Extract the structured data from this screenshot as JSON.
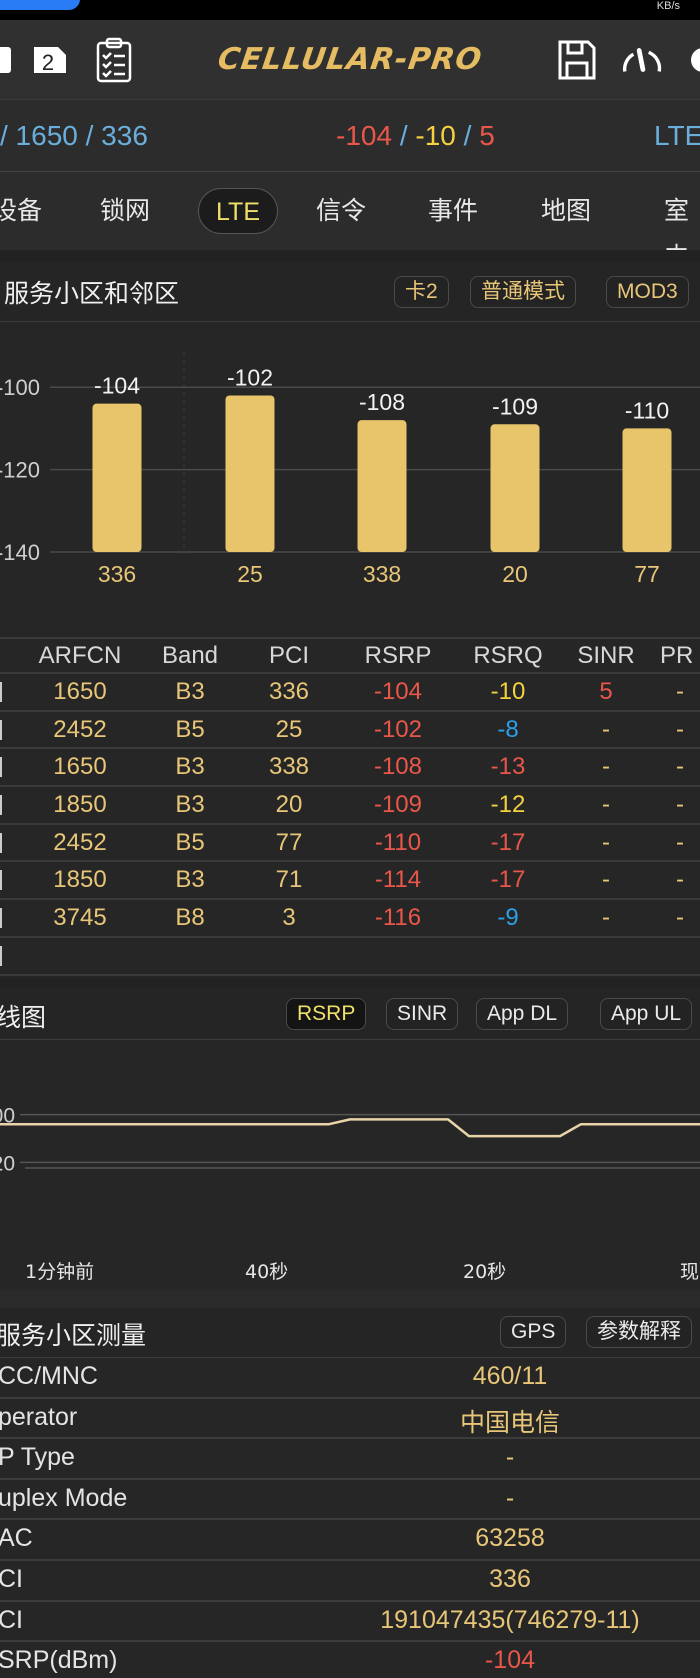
{
  "status_bar": {
    "right_text": "KB/s"
  },
  "app_bar": {
    "title": "CELLULAR-PRO",
    "sim_badge": "2",
    "icons": [
      "sim-card-icon",
      "clipboard-checklist-icon",
      "save-icon",
      "speedometer-icon",
      "settings-icon"
    ]
  },
  "summary": {
    "left": "/ 1650 / 336",
    "rsrp": "-104",
    "rsrq": "-10",
    "sinr": "5",
    "sep": "/",
    "tech": "LTE"
  },
  "tabs": [
    {
      "label": "设备",
      "active": false
    },
    {
      "label": "锁网",
      "active": false
    },
    {
      "label": "LTE",
      "active": true
    },
    {
      "label": "信令",
      "active": false
    },
    {
      "label": "事件",
      "active": false
    },
    {
      "label": "地图",
      "active": false
    },
    {
      "label": "室内",
      "active": false
    }
  ],
  "cells_section": {
    "title": "服务小区和邻区",
    "chips": [
      "卡2",
      "普通模式",
      "MOD3"
    ]
  },
  "chart_data": [
    {
      "type": "bar",
      "title": "RSRP by PCI",
      "categories": [
        "336",
        "25",
        "338",
        "20",
        "77"
      ],
      "values": [
        -104,
        -102,
        -108,
        -109,
        -110
      ],
      "data_labels": [
        "-104",
        "-102",
        "-108",
        "-109",
        "-110"
      ],
      "ytick_labels": [
        "-100",
        "-120",
        "-140"
      ],
      "yticks": [
        -100,
        -120,
        -140
      ],
      "ylim": [
        -140,
        -90
      ],
      "color": "#e8c46a",
      "grid": true
    },
    {
      "type": "line",
      "title": "RSRP trend",
      "x_labels": [
        "1分钟前",
        "40秒",
        "20秒",
        "现"
      ],
      "ytick_labels": [
        "00",
        "20"
      ],
      "yticks": [
        -100,
        -120
      ],
      "ylim": [
        -140,
        -80
      ],
      "x": [
        0,
        0.47,
        0.5,
        0.64,
        0.67,
        0.8,
        0.83,
        1
      ],
      "values": [
        -104,
        -104,
        -102,
        -102,
        -109,
        -109,
        -104,
        -104
      ],
      "color": "#e8d4a8",
      "grid": true
    }
  ],
  "table": {
    "headers": [
      "ARFCN",
      "Band",
      "PCI",
      "RSRP",
      "RSRQ",
      "SINR",
      "PR"
    ],
    "rows": [
      {
        "lead": "P",
        "arfcn": "1650",
        "band": "B3",
        "pci": "336",
        "rsrp": "-104",
        "rsrq": "-10",
        "rsrq_color": "yellow",
        "sinr": "5",
        "sinr_color": "red",
        "pr": "-"
      },
      {
        "lead": "N",
        "arfcn": "2452",
        "band": "B5",
        "pci": "25",
        "rsrp": "-102",
        "rsrq": "-8",
        "rsrq_color": "lightblue",
        "sinr": "-",
        "sinr_color": "gold",
        "pr": "-"
      },
      {
        "lead": "N",
        "arfcn": "1650",
        "band": "B3",
        "pci": "338",
        "rsrp": "-108",
        "rsrq": "-13",
        "rsrq_color": "red",
        "sinr": "-",
        "sinr_color": "gold",
        "pr": "-"
      },
      {
        "lead": "N",
        "arfcn": "1850",
        "band": "B3",
        "pci": "20",
        "rsrp": "-109",
        "rsrq": "-12",
        "rsrq_color": "yellow",
        "sinr": "-",
        "sinr_color": "gold",
        "pr": "-"
      },
      {
        "lead": "N",
        "arfcn": "2452",
        "band": "B5",
        "pci": "77",
        "rsrp": "-110",
        "rsrq": "-17",
        "rsrq_color": "red",
        "sinr": "-",
        "sinr_color": "gold",
        "pr": "-"
      },
      {
        "lead": "N",
        "arfcn": "1850",
        "band": "B3",
        "pci": "71",
        "rsrp": "-114",
        "rsrq": "-17",
        "rsrq_color": "red",
        "sinr": "-",
        "sinr_color": "gold",
        "pr": "-"
      },
      {
        "lead": "N",
        "arfcn": "3745",
        "band": "B8",
        "pci": "3",
        "rsrp": "-116",
        "rsrq": "-9",
        "rsrq_color": "lightblue",
        "sinr": "-",
        "sinr_color": "gold",
        "pr": "-"
      },
      {
        "lead": "N",
        "arfcn": "",
        "band": "",
        "pci": "",
        "rsrp": "",
        "rsrq": "",
        "rsrq_color": "gold",
        "sinr": "",
        "sinr_color": "gold",
        "pr": ""
      }
    ]
  },
  "trend_section": {
    "title": "线图",
    "chips": [
      "RSRP",
      "SINR",
      "App DL",
      "App UL"
    ],
    "selected": "RSRP"
  },
  "measure_section": {
    "title": "服务小区测量",
    "chips": [
      "GPS",
      "参数解释"
    ],
    "rows": [
      {
        "label": "CC/MNC",
        "value": "460/11",
        "color": "gold"
      },
      {
        "label": "perator",
        "value": "中国电信",
        "color": "gold"
      },
      {
        "label": "P Type",
        "value": "-",
        "color": "gold"
      },
      {
        "label": "uplex Mode",
        "value": "-",
        "color": "gold"
      },
      {
        "label": "AC",
        "value": "63258",
        "color": "gold"
      },
      {
        "label": "CI",
        "value": "336",
        "color": "gold"
      },
      {
        "label": "CI",
        "value": "191047435(746279-11)",
        "color": "gold"
      },
      {
        "label": "SRP(dBm)",
        "value": "-104",
        "color": "red"
      }
    ]
  },
  "colors": {
    "gold": "#e8c678",
    "red": "#e8574a",
    "yellow": "#f3d23e",
    "lightblue": "#2aa0e8",
    "blue": "#6aaedc",
    "bar": "#e8c46a"
  }
}
